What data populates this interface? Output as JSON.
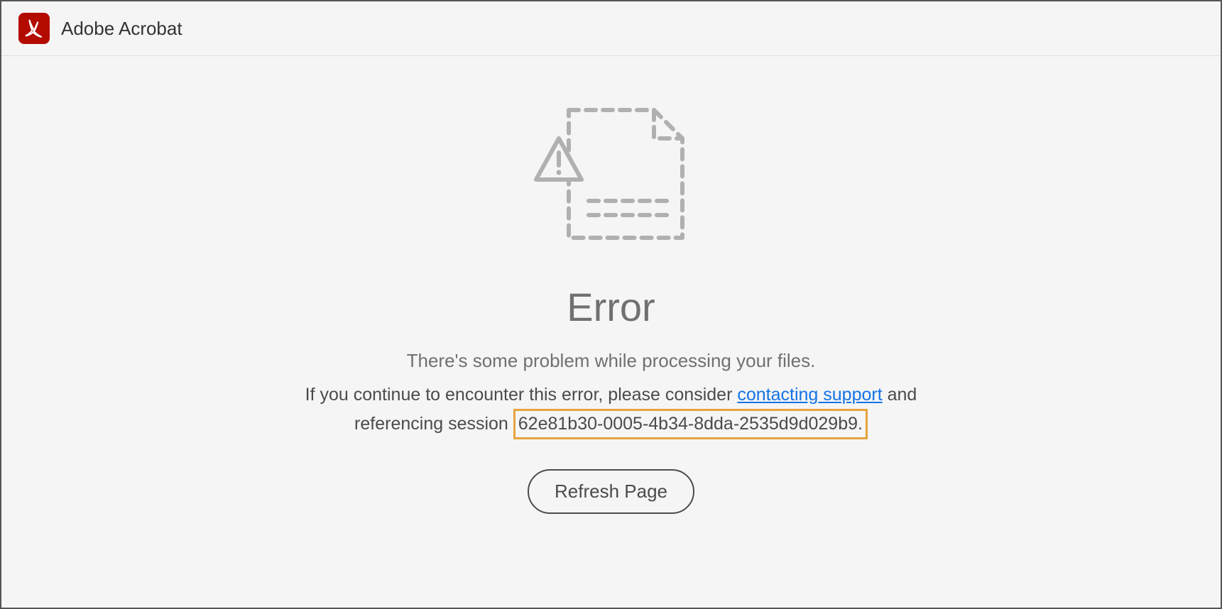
{
  "header": {
    "app_title": "Adobe Acrobat"
  },
  "error": {
    "heading": "Error",
    "subtitle": "There's some problem while processing your files.",
    "description_prefix": "If you continue to encounter this error, please consider ",
    "support_link_text": "contacting support",
    "description_middle": " and referencing session ",
    "session_id": "62e81b30-0005-4b34-8dda-2535d9d029b9.",
    "refresh_button_label": "Refresh Page"
  }
}
